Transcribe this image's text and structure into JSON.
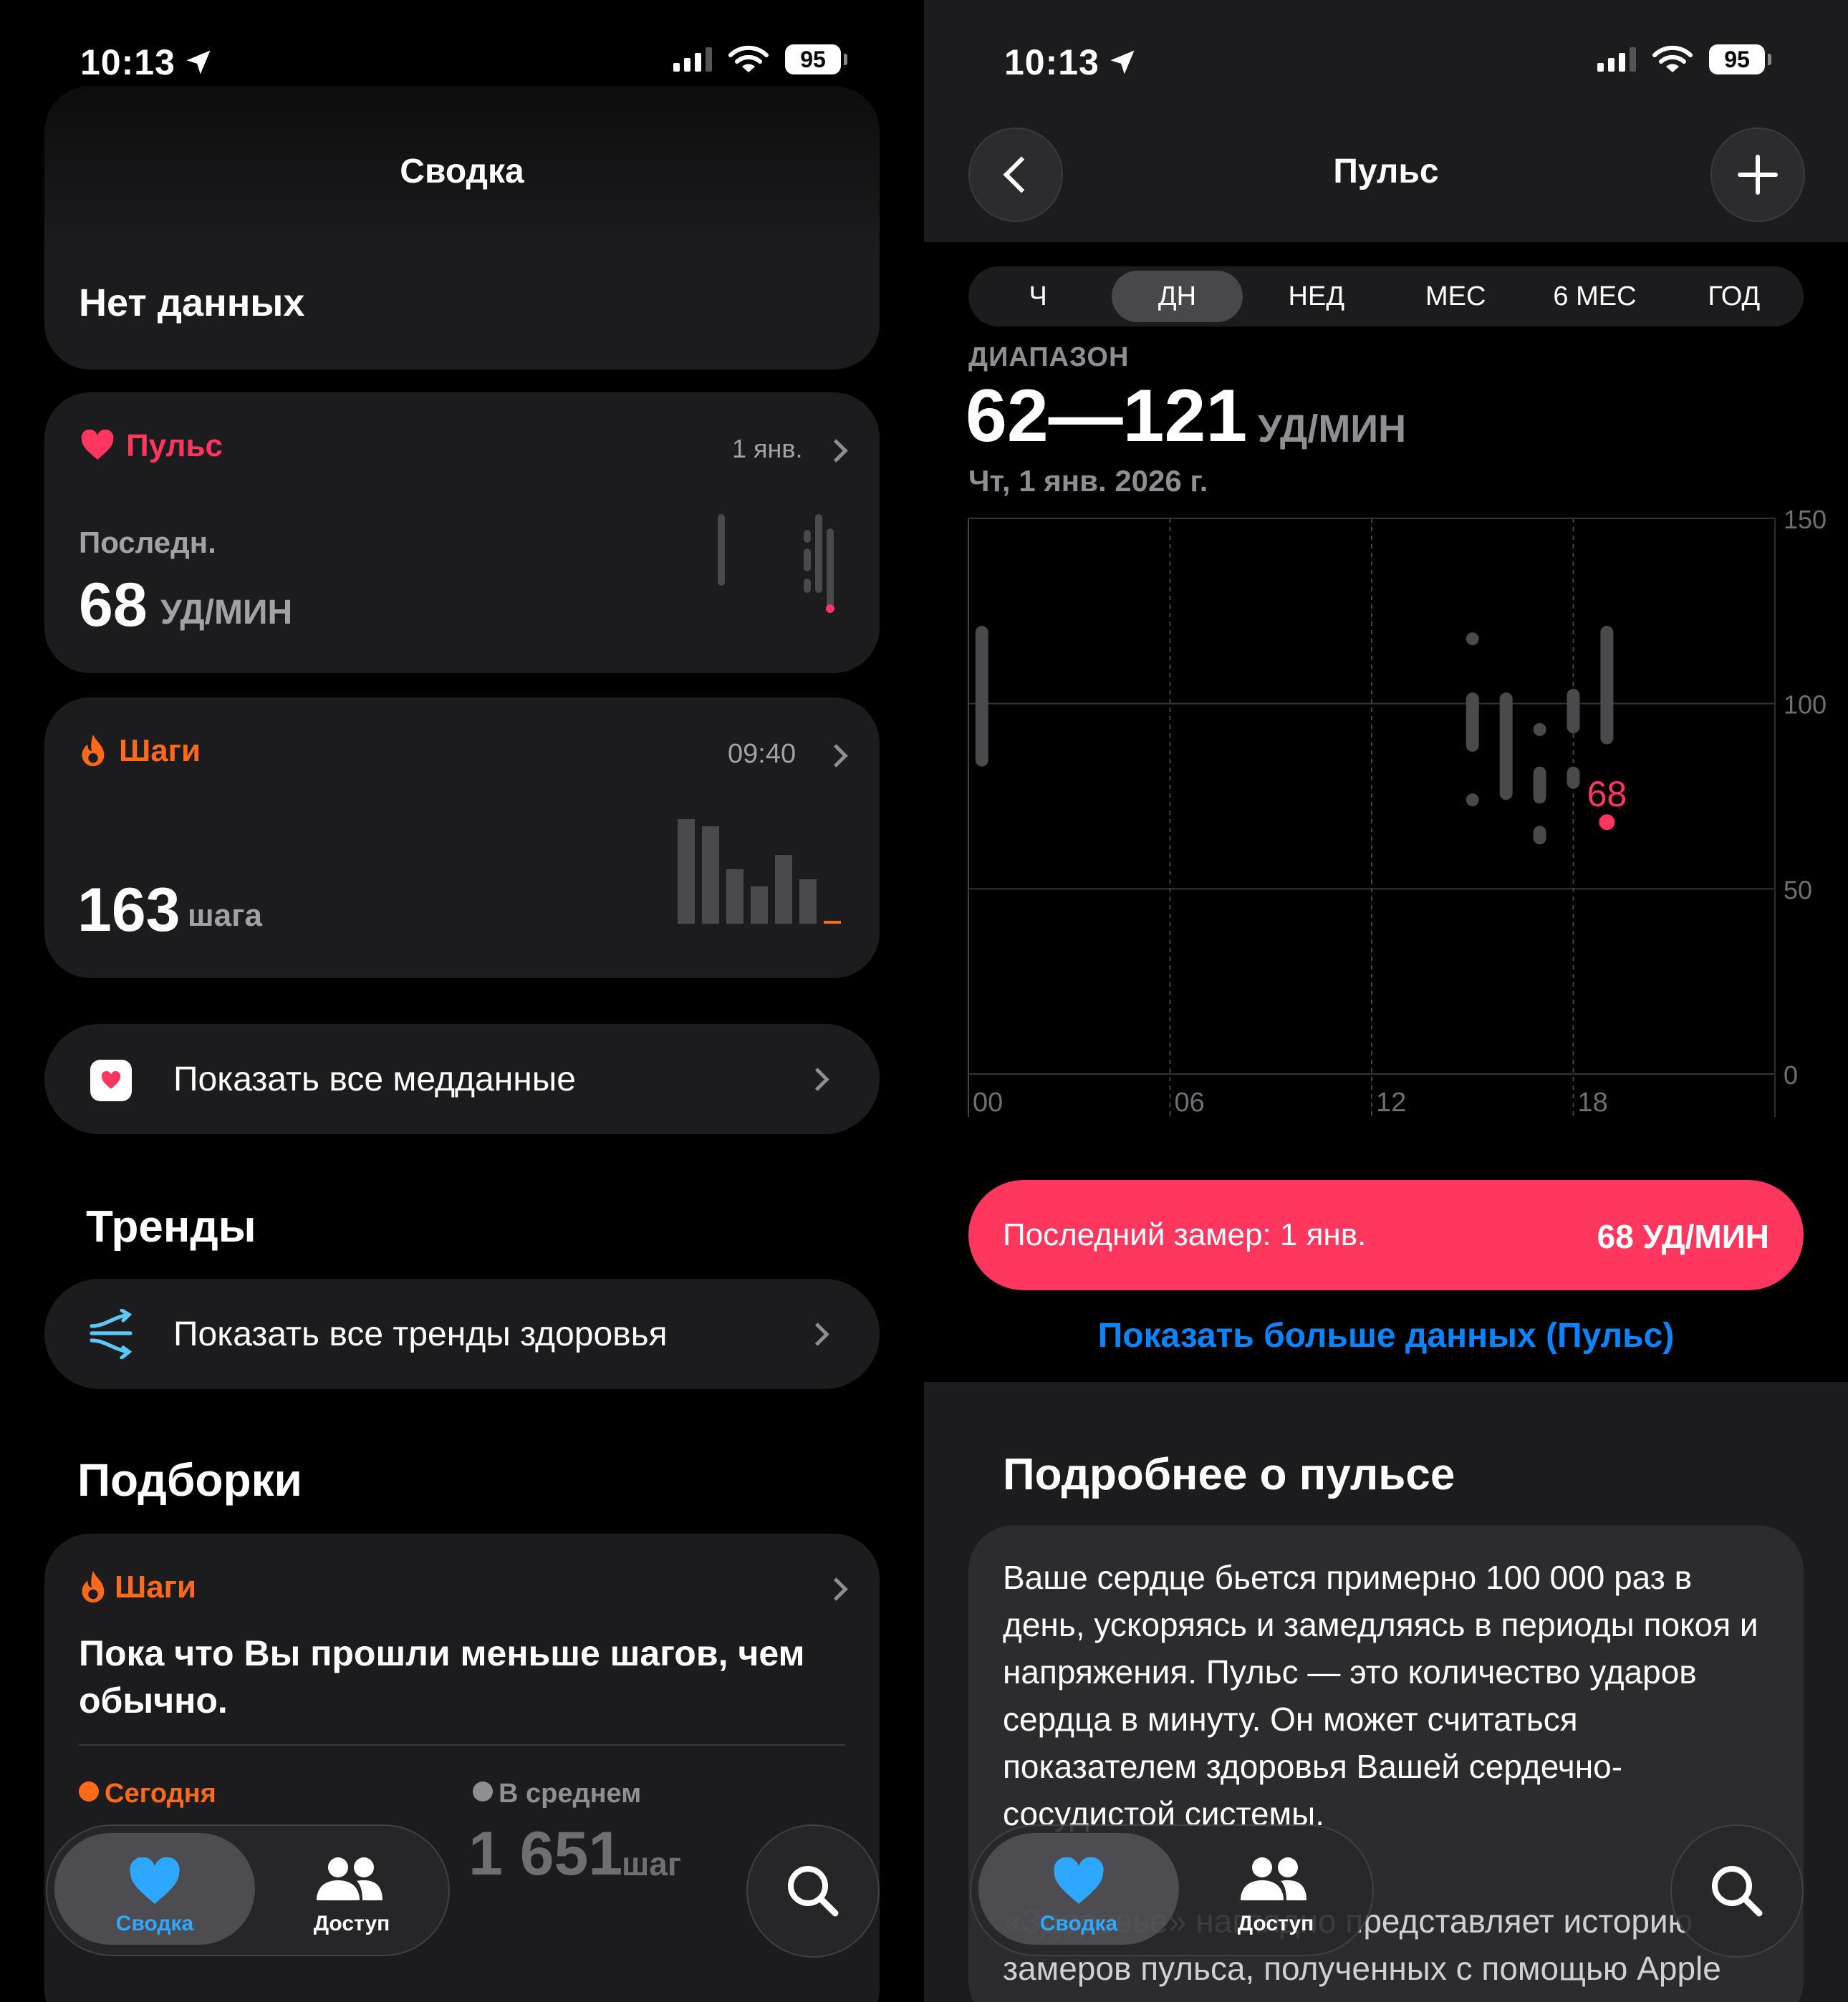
{
  "status": {
    "time": "10:13",
    "battery": "95"
  },
  "left": {
    "header": {
      "title": "Сводка"
    },
    "no_data": {
      "text": "Нет данных"
    },
    "pulse_card": {
      "title": "Пульс",
      "date": "1 янв.",
      "label": "Последн.",
      "value": "68",
      "unit": "УД/МИН"
    },
    "steps_card": {
      "title": "Шаги",
      "time": "09:40",
      "value": "163",
      "unit": "шага"
    },
    "show_all_health": {
      "label": "Показать все медданные"
    },
    "trends": {
      "heading": "Тренды",
      "show_all": "Показать все тренды здоровья"
    },
    "highlights": {
      "heading": "Подборки",
      "card": {
        "title": "Шаги",
        "text": "Пока что Вы прошли меньше шагов, чем обычно.",
        "today_label": "Сегодня",
        "avg_label": "В среднем",
        "avg_value": "1 651",
        "avg_unit": "шаг"
      }
    }
  },
  "right": {
    "header": {
      "title": "Пульс"
    },
    "segments": [
      "Ч",
      "ДН",
      "НЕД",
      "МЕС",
      "6 МЕС",
      "ГОД"
    ],
    "selected_segment": "ДН",
    "range": {
      "label": "ДИАПАЗОН",
      "value": "62—121",
      "unit": "УД/МИН",
      "date": "Чт, 1 янв. 2026 г."
    },
    "latest": {
      "label": "Последний замер: 1 янв.",
      "value": "68 УД/МИН"
    },
    "more_link": "Показать больше данных (Пульс)",
    "about": {
      "heading": "Подробнее о пульсе",
      "text": "Ваше сердце бьется примерно 100 000 раз в день, ускоряясь и замедляясь в периоды покоя и напряжения. Пульс — это количество ударов сердца в минуту. Он может считаться показателем здоровья Вашей сердечно-сосудистой системы.",
      "text2": "«Здоровье» наглядно представляет историю замеров пульса, полученных с помощью Apple Watch"
    }
  },
  "tabbar": {
    "summary": "Сводка",
    "sharing": "Доступ"
  },
  "colors": {
    "pulse": "#ff375f",
    "steps": "#ff6a1a",
    "link": "#0a84ff",
    "card": "#1c1c1e"
  },
  "chart_data": {
    "type": "range-bar",
    "x_ticks": [
      "00",
      "06",
      "12",
      "18"
    ],
    "y_ticks": [
      0,
      50,
      100,
      150
    ],
    "ylim": [
      0,
      150
    ],
    "xlim_hours": [
      0,
      24
    ],
    "bars": [
      {
        "hour": 0.4,
        "low": 83,
        "high": 121
      },
      {
        "hour": 15.0,
        "low": 117,
        "high": 118
      },
      {
        "hour": 15.0,
        "low": 87,
        "high": 103
      },
      {
        "hour": 15.0,
        "low": 73,
        "high": 75
      },
      {
        "hour": 16.0,
        "low": 74,
        "high": 103
      },
      {
        "hour": 17.0,
        "low": 92,
        "high": 94
      },
      {
        "hour": 17.0,
        "low": 73,
        "high": 83
      },
      {
        "hour": 17.0,
        "low": 62,
        "high": 67
      },
      {
        "hour": 18.0,
        "low": 92,
        "high": 104
      },
      {
        "hour": 18.0,
        "low": 77,
        "high": 83
      },
      {
        "hour": 19.0,
        "low": 89,
        "high": 121
      }
    ],
    "latest_point": {
      "hour": 19.0,
      "value": 68,
      "label": "68"
    }
  }
}
